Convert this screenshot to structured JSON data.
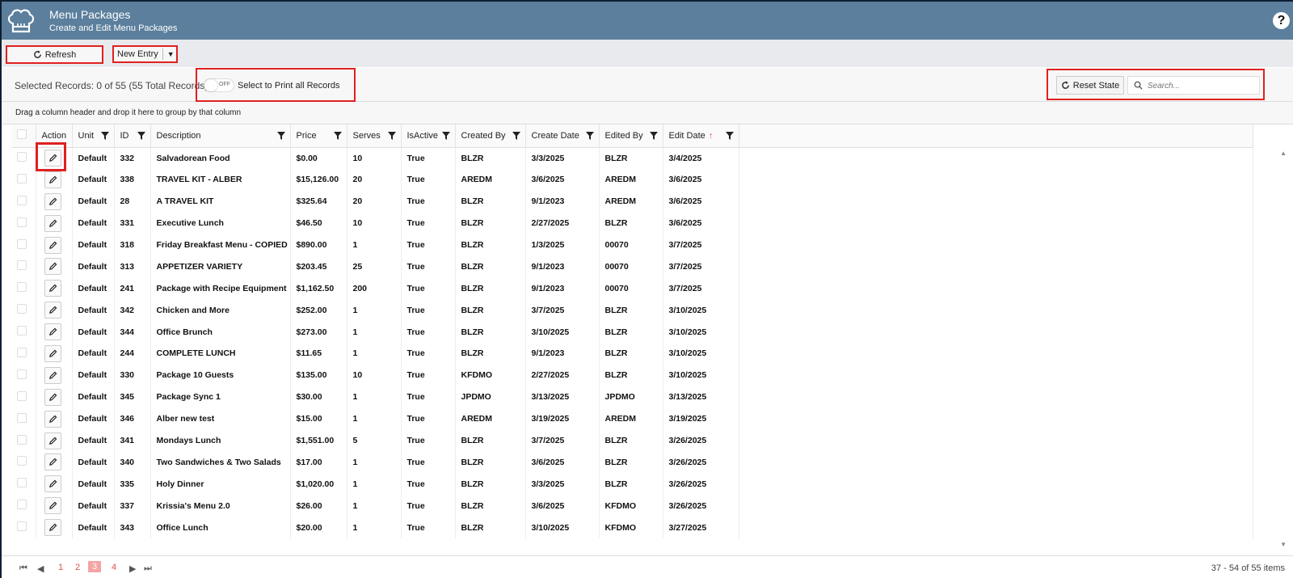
{
  "header": {
    "title": "Menu Packages",
    "subtitle": "Create and Edit Menu Packages",
    "help": "?"
  },
  "toolbar": {
    "refresh_label": "Refresh",
    "new_entry_label": "New Entry"
  },
  "info": {
    "selected_text": "Selected Records: 0 of 55 (55 Total Records)",
    "toggle_state": "OFF",
    "print_label": "Select to Print all Records",
    "reset_label": "Reset State",
    "search_placeholder": "Search..."
  },
  "group_hint": "Drag a column header and drop it here to group by that column",
  "columns": [
    "Action",
    "Unit",
    "ID",
    "Description",
    "Price",
    "Serves",
    "IsActive",
    "Created By",
    "Create Date",
    "Edited By",
    "Edit Date"
  ],
  "rows": [
    {
      "unit": "Default",
      "id": "332",
      "description": "Salvadorean Food",
      "price": "$0.00",
      "serves": "10",
      "isactive": "True",
      "created_by": "BLZR",
      "create_date": "3/3/2025",
      "edited_by": "BLZR",
      "edit_date": "3/4/2025"
    },
    {
      "unit": "Default",
      "id": "338",
      "description": "TRAVEL KIT - ALBER",
      "price": "$15,126.00",
      "serves": "20",
      "isactive": "True",
      "created_by": "AREDM",
      "create_date": "3/6/2025",
      "edited_by": "AREDM",
      "edit_date": "3/6/2025"
    },
    {
      "unit": "Default",
      "id": "28",
      "description": "A TRAVEL KIT",
      "price": "$325.64",
      "serves": "20",
      "isactive": "True",
      "created_by": "BLZR",
      "create_date": "9/1/2023",
      "edited_by": "AREDM",
      "edit_date": "3/6/2025"
    },
    {
      "unit": "Default",
      "id": "331",
      "description": "Executive Lunch",
      "price": "$46.50",
      "serves": "10",
      "isactive": "True",
      "created_by": "BLZR",
      "create_date": "2/27/2025",
      "edited_by": "BLZR",
      "edit_date": "3/6/2025"
    },
    {
      "unit": "Default",
      "id": "318",
      "description": "Friday Breakfast Menu - COPIED",
      "price": "$890.00",
      "serves": "1",
      "isactive": "True",
      "created_by": "BLZR",
      "create_date": "1/3/2025",
      "edited_by": "00070",
      "edit_date": "3/7/2025"
    },
    {
      "unit": "Default",
      "id": "313",
      "description": "APPETIZER VARIETY",
      "price": "$203.45",
      "serves": "25",
      "isactive": "True",
      "created_by": "BLZR",
      "create_date": "9/1/2023",
      "edited_by": "00070",
      "edit_date": "3/7/2025"
    },
    {
      "unit": "Default",
      "id": "241",
      "description": "Package with Recipe Equipment",
      "price": "$1,162.50",
      "serves": "200",
      "isactive": "True",
      "created_by": "BLZR",
      "create_date": "9/1/2023",
      "edited_by": "00070",
      "edit_date": "3/7/2025"
    },
    {
      "unit": "Default",
      "id": "342",
      "description": "Chicken and More",
      "price": "$252.00",
      "serves": "1",
      "isactive": "True",
      "created_by": "BLZR",
      "create_date": "3/7/2025",
      "edited_by": "BLZR",
      "edit_date": "3/10/2025"
    },
    {
      "unit": "Default",
      "id": "344",
      "description": "Office Brunch",
      "price": "$273.00",
      "serves": "1",
      "isactive": "True",
      "created_by": "BLZR",
      "create_date": "3/10/2025",
      "edited_by": "BLZR",
      "edit_date": "3/10/2025"
    },
    {
      "unit": "Default",
      "id": "244",
      "description": "COMPLETE LUNCH",
      "price": "$11.65",
      "serves": "1",
      "isactive": "True",
      "created_by": "BLZR",
      "create_date": "9/1/2023",
      "edited_by": "BLZR",
      "edit_date": "3/10/2025"
    },
    {
      "unit": "Default",
      "id": "330",
      "description": "Package 10 Guests",
      "price": "$135.00",
      "serves": "10",
      "isactive": "True",
      "created_by": "KFDMO",
      "create_date": "2/27/2025",
      "edited_by": "BLZR",
      "edit_date": "3/10/2025"
    },
    {
      "unit": "Default",
      "id": "345",
      "description": "Package Sync 1",
      "price": "$30.00",
      "serves": "1",
      "isactive": "True",
      "created_by": "JPDMO",
      "create_date": "3/13/2025",
      "edited_by": "JPDMO",
      "edit_date": "3/13/2025"
    },
    {
      "unit": "Default",
      "id": "346",
      "description": "Alber new test",
      "price": "$15.00",
      "serves": "1",
      "isactive": "True",
      "created_by": "AREDM",
      "create_date": "3/19/2025",
      "edited_by": "AREDM",
      "edit_date": "3/19/2025"
    },
    {
      "unit": "Default",
      "id": "341",
      "description": "Mondays Lunch",
      "price": "$1,551.00",
      "serves": "5",
      "isactive": "True",
      "created_by": "BLZR",
      "create_date": "3/7/2025",
      "edited_by": "BLZR",
      "edit_date": "3/26/2025"
    },
    {
      "unit": "Default",
      "id": "340",
      "description": "Two Sandwiches & Two Salads",
      "price": "$17.00",
      "serves": "1",
      "isactive": "True",
      "created_by": "BLZR",
      "create_date": "3/6/2025",
      "edited_by": "BLZR",
      "edit_date": "3/26/2025"
    },
    {
      "unit": "Default",
      "id": "335",
      "description": "Holy Dinner",
      "price": "$1,020.00",
      "serves": "1",
      "isactive": "True",
      "created_by": "BLZR",
      "create_date": "3/3/2025",
      "edited_by": "BLZR",
      "edit_date": "3/26/2025"
    },
    {
      "unit": "Default",
      "id": "337",
      "description": "Krissia's Menu 2.0",
      "price": "$26.00",
      "serves": "1",
      "isactive": "True",
      "created_by": "BLZR",
      "create_date": "3/6/2025",
      "edited_by": "KFDMO",
      "edit_date": "3/26/2025"
    },
    {
      "unit": "Default",
      "id": "343",
      "description": "Office Lunch",
      "price": "$20.00",
      "serves": "1",
      "isactive": "True",
      "created_by": "BLZR",
      "create_date": "3/10/2025",
      "edited_by": "KFDMO",
      "edit_date": "3/27/2025"
    }
  ],
  "pager": {
    "first": "⏮",
    "prev": "◀",
    "pages": [
      "1",
      "2",
      "3",
      "4"
    ],
    "current": "3",
    "next": "▶",
    "last": "⏭",
    "info": "37 - 54 of 55 items"
  },
  "colors": {
    "header_bg": "#5b7f9c",
    "highlight": "#e02020",
    "pager_accent": "#e05050"
  }
}
